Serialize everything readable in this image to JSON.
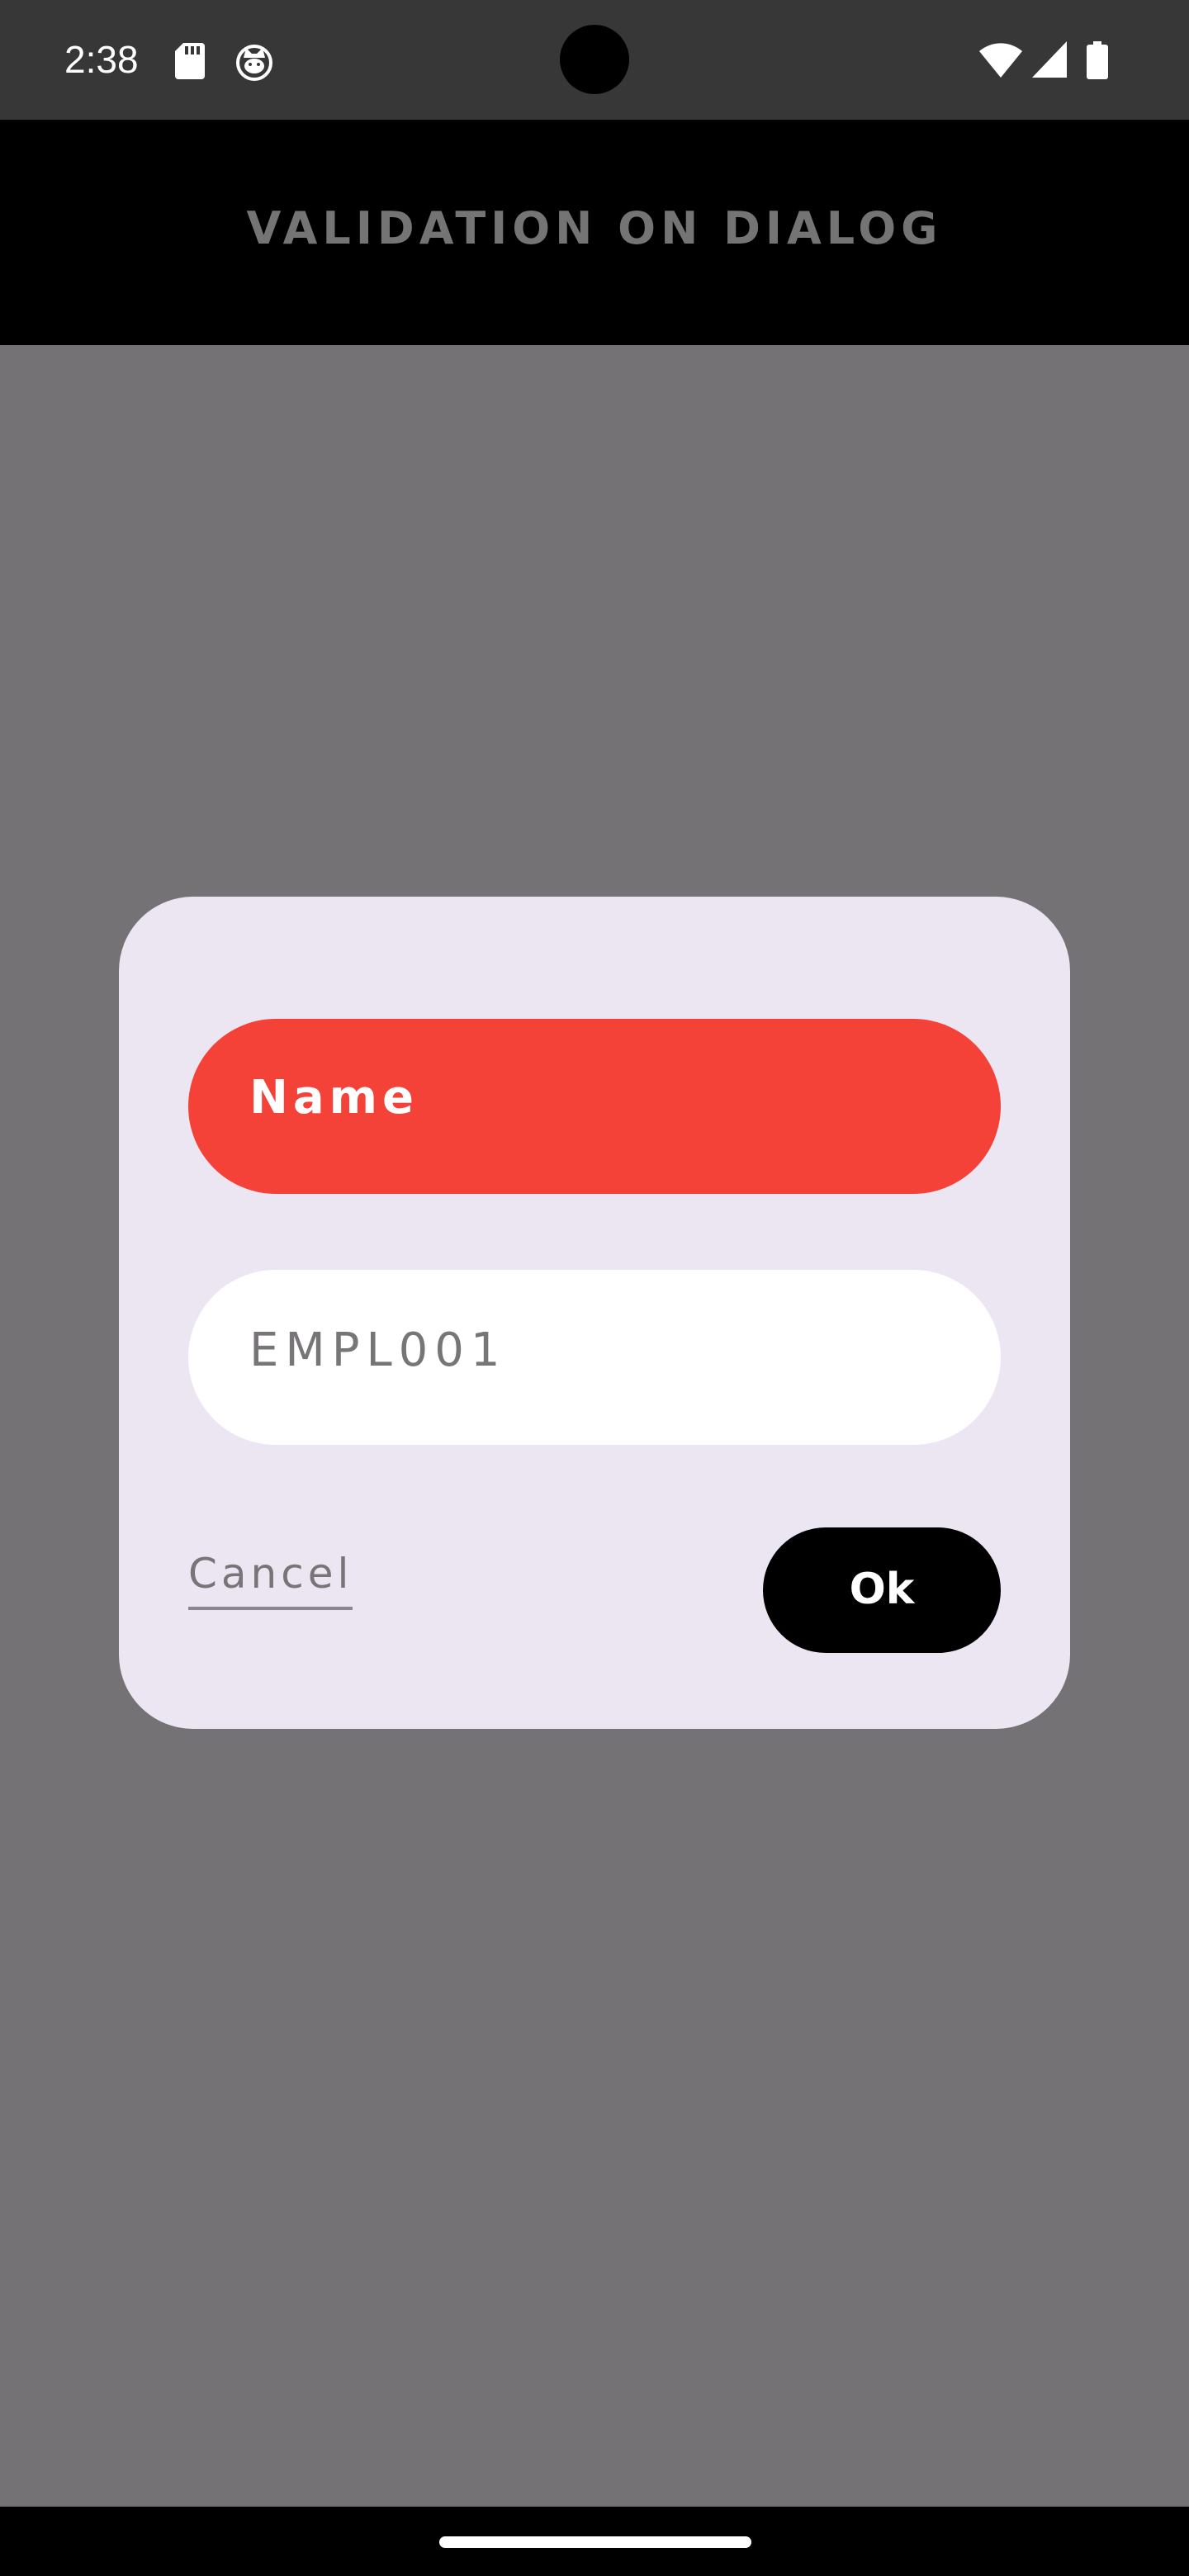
{
  "status_bar": {
    "time": "2:38",
    "left_icons": [
      "sd-card-icon",
      "cat-icon"
    ],
    "right_icons": [
      "wifi-icon",
      "cellular-signal-icon",
      "battery-icon"
    ]
  },
  "app_bar": {
    "title": "VALIDATION ON DIALOG"
  },
  "dialog": {
    "name_field": {
      "placeholder": "Name",
      "state": "error",
      "color": "#f44239"
    },
    "employee_id_field": {
      "value": "EMPL001"
    },
    "cancel_label": "Cancel",
    "ok_label": "Ok"
  },
  "colors": {
    "scrim": "#747275",
    "dialog_background": "#ece6f2",
    "error": "#f44239",
    "ok_button": "#000000",
    "app_bar": "#000000"
  }
}
